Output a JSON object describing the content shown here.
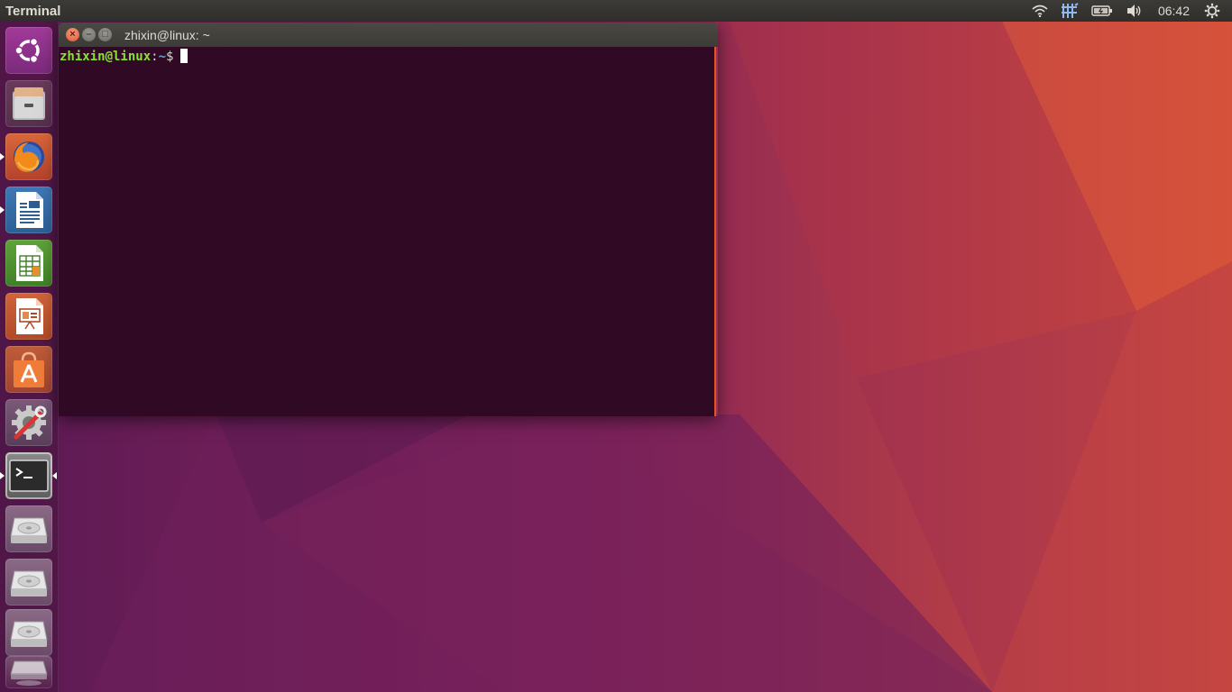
{
  "top_panel": {
    "app_title": "Terminal",
    "clock": "06:42",
    "indicators": [
      "wifi-icon",
      "keyboard-input-icon",
      "battery-icon",
      "volume-icon",
      "system-gear-icon"
    ]
  },
  "launcher": {
    "items": [
      {
        "name": "ubuntu-dash",
        "label": "Search your computer"
      },
      {
        "name": "files",
        "label": "Files"
      },
      {
        "name": "firefox",
        "label": "Firefox Web Browser"
      },
      {
        "name": "writer",
        "label": "LibreOffice Writer"
      },
      {
        "name": "calc",
        "label": "LibreOffice Calc"
      },
      {
        "name": "impress",
        "label": "LibreOffice Impress"
      },
      {
        "name": "software",
        "label": "Ubuntu Software"
      },
      {
        "name": "system-settings",
        "label": "System Settings"
      },
      {
        "name": "terminal",
        "label": "Terminal"
      },
      {
        "name": "drive-1",
        "label": "Drive"
      },
      {
        "name": "drive-2",
        "label": "Drive"
      },
      {
        "name": "drive-3",
        "label": "Drive"
      },
      {
        "name": "drive-4",
        "label": "Drive"
      }
    ]
  },
  "terminal_window": {
    "title": "zhixin@linux: ~",
    "prompt_user_host": "zhixin@linux",
    "prompt_colon": ":",
    "prompt_path": "~",
    "prompt_sign": "$"
  },
  "colors": {
    "accent": "#e95420",
    "terminal_bg": "#300a24",
    "prompt_user": "#8ae234",
    "prompt_path": "#729fcf"
  }
}
